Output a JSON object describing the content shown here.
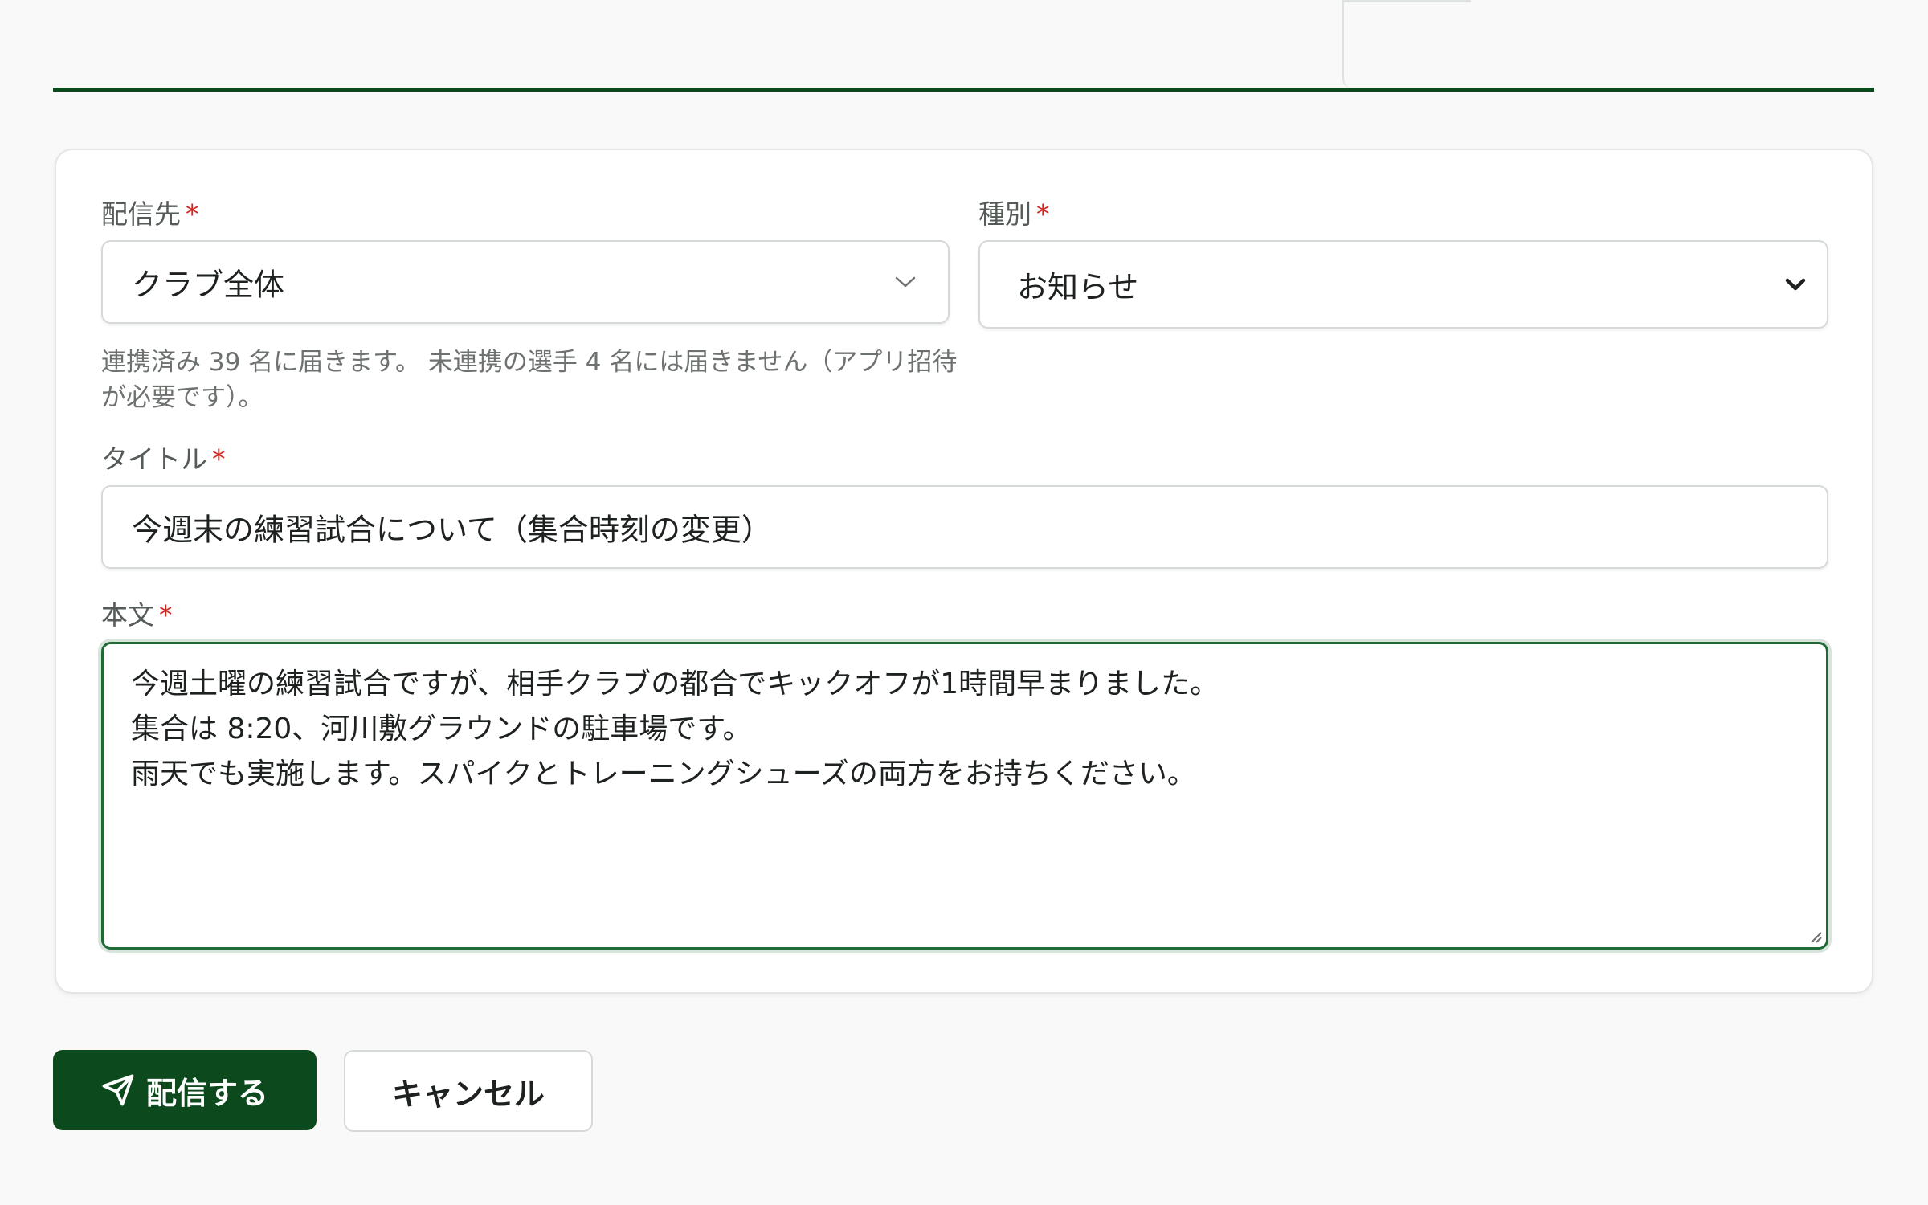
{
  "form": {
    "destination": {
      "label": "配信先",
      "required_mark": "*",
      "value": "クラブ全体",
      "helper": "連携済み 39 名に届きます。 未連携の選手 4 名には届きません（アプリ招待が必要です）。"
    },
    "category": {
      "label": "種別",
      "required_mark": "*",
      "value": "お知らせ"
    },
    "title": {
      "label": "タイトル",
      "required_mark": "*",
      "value": "今週末の練習試合について（集合時刻の変更）"
    },
    "body": {
      "label": "本文",
      "required_mark": "*",
      "value": "今週土曜の練習試合ですが、相手クラブの都合でキックオフが1時間早まりました。\n集合は 8:20、河川敷グラウンドの駐車場です。\n雨天でも実施します。スパイクとトレーニングシューズの両方をお持ちください。"
    }
  },
  "actions": {
    "submit_label": "配信する",
    "submit_icon": "send-icon",
    "cancel_label": "キャンセル"
  },
  "colors": {
    "brand": "#0c4a1e",
    "required": "#d3261f",
    "focus": "#1f6b35"
  }
}
